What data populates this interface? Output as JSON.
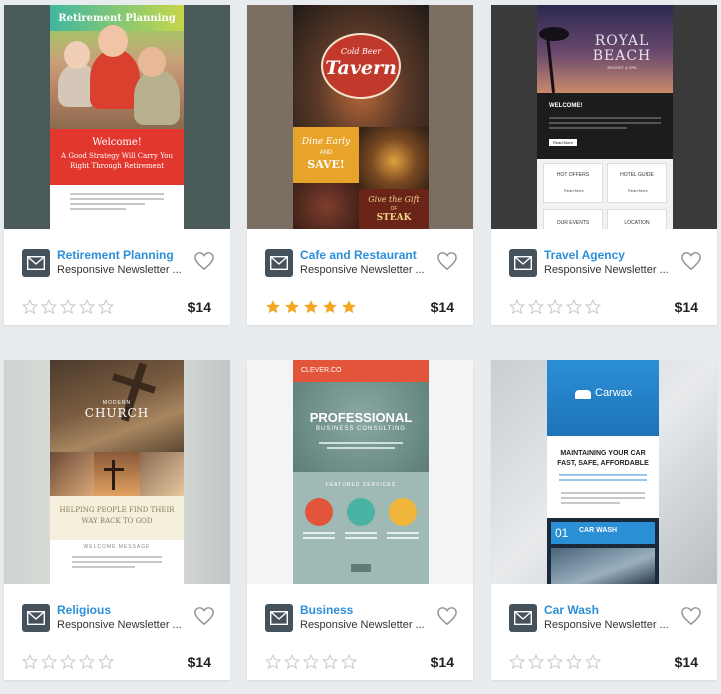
{
  "cards": [
    {
      "title": "Retirement Planning",
      "subtitle": "Responsive Newsletter ...",
      "price": "$14",
      "rating": 0,
      "preview": {
        "header": "Retirement Planning",
        "welcome": "Welcome!",
        "tagline1": "A Good Strategy Will Carry You",
        "tagline2": "Right Through Retirement"
      }
    },
    {
      "title": "Cafe and Restaurant",
      "subtitle": "Responsive Newsletter ...",
      "price": "$14",
      "rating": 5,
      "preview": {
        "sign_top": "Cold Beer",
        "sign_main": "Tavern",
        "promo1_line1": "Dine Early",
        "promo1_line2": "AND",
        "promo1_line3": "SAVE!",
        "promo2_line1": "Give the Gift",
        "promo2_line2": "OF",
        "promo2_line3": "STEAK"
      }
    },
    {
      "title": "Travel Agency",
      "subtitle": "Responsive Newsletter ...",
      "price": "$14",
      "rating": 0,
      "preview": {
        "brand1": "ROYAL",
        "brand2": "BEACH",
        "brand_sub": "RESORT & SPA",
        "welcome": "WELCOME!",
        "btn": "Read More",
        "box1": "HOT OFFERS",
        "box2": "HOTEL GUIDE",
        "box3": "OUR EVENTS",
        "box4": "LOCATION",
        "box_btn": "Read More"
      }
    },
    {
      "title": "Religious",
      "subtitle": "Responsive Newsletter ...",
      "price": "$14",
      "rating": 0,
      "preview": {
        "small": "MODERN",
        "main": "CHURCH",
        "tag1": "HELPING PEOPLE FIND THEIR",
        "tag2": "WAY BACK TO GOD",
        "foot": "WELCOME MESSAGE"
      }
    },
    {
      "title": "Business",
      "subtitle": "Responsive Newsletter ...",
      "price": "$14",
      "rating": 0,
      "preview": {
        "brand": "CLEVER.CO",
        "main": "PROFESSIONAL",
        "sub": "BUSINESS CONSULTING",
        "featured": "FEATURED SERVICES"
      }
    },
    {
      "title": "Car Wash",
      "subtitle": "Responsive Newsletter ...",
      "price": "$14",
      "rating": 0,
      "preview": {
        "brand": "Carwax",
        "head1": "MAINTAINING YOUR CAR",
        "head2": "FAST, SAFE, AFFORDABLE",
        "num": "01",
        "service": "CAR WASH"
      }
    }
  ],
  "colors": {
    "title_blue": "#2d8fd8",
    "star_gold": "#f5a623",
    "star_empty": "#c9c9c9",
    "icon_slate": "#45525c",
    "page_bg": "#e8ecef"
  }
}
